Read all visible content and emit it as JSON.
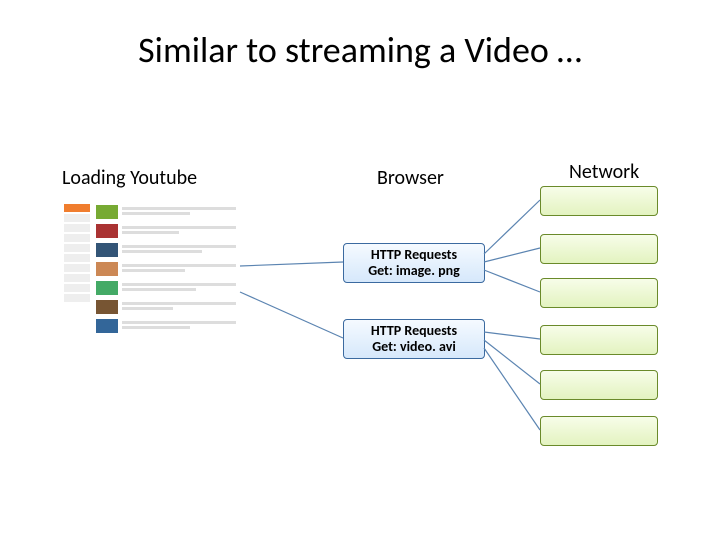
{
  "title": "Similar to streaming a Video …",
  "columns": {
    "left": "Loading Youtube",
    "mid": "Browser",
    "right": "Network"
  },
  "http1": {
    "line1": "HTTP Requests",
    "line2": "Get: image. png"
  },
  "http2": {
    "line1": "HTTP Requests",
    "line2": "Get: video. avi"
  },
  "chart_data": {
    "type": "diagram",
    "nodes": [
      {
        "id": "youtube",
        "label": "Loading Youtube (screenshot)"
      },
      {
        "id": "http_image",
        "label": "HTTP Requests Get: image.png"
      },
      {
        "id": "http_video",
        "label": "HTTP Requests Get: video.avi"
      },
      {
        "id": "net1",
        "label": "Network box 1"
      },
      {
        "id": "net2",
        "label": "Network box 2"
      },
      {
        "id": "net3",
        "label": "Network box 3"
      },
      {
        "id": "net4",
        "label": "Network box 4"
      },
      {
        "id": "net5",
        "label": "Network box 5"
      },
      {
        "id": "net6",
        "label": "Network box 6"
      }
    ],
    "edges": [
      {
        "from": "youtube",
        "to": "http_image"
      },
      {
        "from": "youtube",
        "to": "http_video"
      },
      {
        "from": "http_image",
        "to": "net1"
      },
      {
        "from": "http_image",
        "to": "net2"
      },
      {
        "from": "http_image",
        "to": "net3"
      },
      {
        "from": "http_video",
        "to": "net4"
      },
      {
        "from": "http_video",
        "to": "net5"
      },
      {
        "from": "http_video",
        "to": "net6"
      }
    ]
  }
}
